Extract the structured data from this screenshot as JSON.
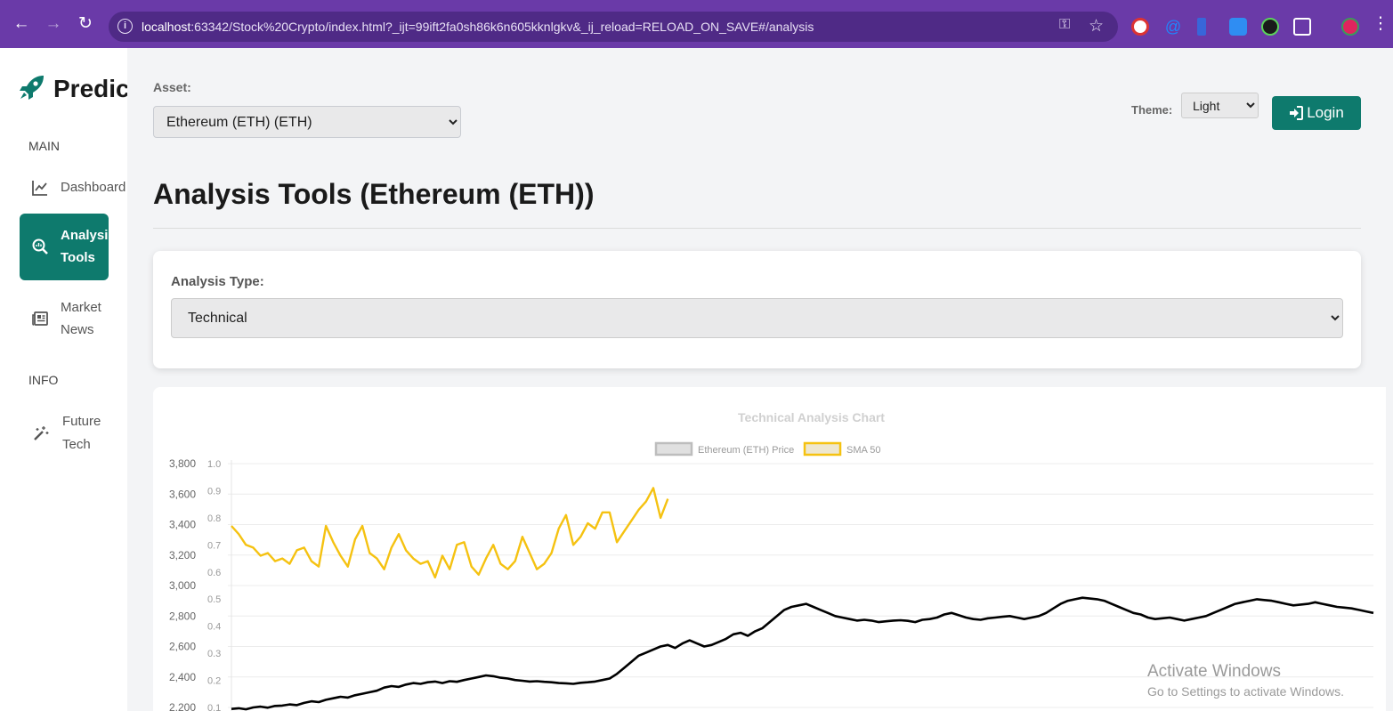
{
  "browser": {
    "url_host": "localhost",
    "url_path": ":63342/Stock%20Crypto/index.html?_ijt=99ift2fa0sh86k6n605kknlgkv&_ij_reload=RELOAD_ON_SAVE#/analysis",
    "icons": [
      "back-icon",
      "forward-icon",
      "reload-icon",
      "site-info-icon",
      "key-icon",
      "star-icon",
      "extensions-icon",
      "menu-icon"
    ]
  },
  "sidebar": {
    "logo_text": "Predic",
    "main_header": "MAIN",
    "info_header": "INFO",
    "items": [
      {
        "label_lines": [
          "Dashboard"
        ],
        "icon": "line-chart-icon",
        "active": false
      },
      {
        "label_lines": [
          "Analysis",
          "Tools"
        ],
        "icon": "search-chart-icon",
        "active": true
      },
      {
        "label_lines": [
          "Market",
          "News"
        ],
        "icon": "newspaper-icon",
        "active": false
      },
      {
        "label_lines": [
          "Future",
          "Tech"
        ],
        "icon": "magic-wand-icon",
        "active": false
      }
    ]
  },
  "header": {
    "asset_label": "Asset:",
    "asset_selected": "Ethereum (ETH) (ETH)",
    "theme_label": "Theme:",
    "theme_selected": "Light",
    "login_label": "Login",
    "page_title": "Analysis Tools (Ethereum (ETH))"
  },
  "analysis": {
    "type_label": "Analysis Type:",
    "type_selected": "Technical"
  },
  "chart_data": {
    "type": "line",
    "title": "Technical Analysis Chart",
    "legend_position": "top-center",
    "grid": true,
    "y_left": {
      "ticks": [
        "3,800",
        "3,600",
        "3,400",
        "3,200",
        "3,000",
        "2,800",
        "2,600",
        "2,400",
        "2,200"
      ],
      "range": [
        2200,
        3800
      ]
    },
    "y_right": {
      "ticks": [
        "1.0",
        "0.9",
        "0.8",
        "0.7",
        "0.6",
        "0.5",
        "0.4",
        "0.3",
        "0.2",
        "0.1"
      ],
      "range": [
        0.1,
        1.0
      ]
    },
    "series": [
      {
        "name": "Ethereum (ETH) Price",
        "color": "#000000",
        "axis": "left",
        "values": [
          2190,
          2195,
          2188,
          2200,
          2205,
          2198,
          2210,
          2212,
          2220,
          2215,
          2230,
          2240,
          2235,
          2250,
          2260,
          2270,
          2265,
          2280,
          2290,
          2300,
          2310,
          2330,
          2340,
          2335,
          2350,
          2360,
          2355,
          2365,
          2370,
          2360,
          2372,
          2368,
          2380,
          2390,
          2400,
          2410,
          2405,
          2395,
          2390,
          2380,
          2375,
          2370,
          2372,
          2368,
          2365,
          2360,
          2358,
          2355,
          2362,
          2365,
          2370,
          2380,
          2390,
          2420,
          2460,
          2500,
          2540,
          2560,
          2580,
          2600,
          2610,
          2590,
          2620,
          2640,
          2620,
          2600,
          2610,
          2630,
          2650,
          2680,
          2690,
          2670,
          2700,
          2720,
          2760,
          2800,
          2840,
          2860,
          2870,
          2880,
          2860,
          2840,
          2820,
          2800,
          2790,
          2780,
          2770,
          2775,
          2770,
          2760,
          2765,
          2770,
          2772,
          2768,
          2760,
          2775,
          2780,
          2790,
          2810,
          2820,
          2805,
          2790,
          2780,
          2775,
          2785,
          2790,
          2795,
          2800,
          2790,
          2780,
          2790,
          2800,
          2820,
          2850,
          2880,
          2900,
          2910,
          2920,
          2915,
          2910,
          2900,
          2880,
          2860,
          2840,
          2820,
          2810,
          2790,
          2780,
          2785,
          2790,
          2780,
          2770,
          2780,
          2790,
          2800,
          2820,
          2840,
          2860,
          2880,
          2890,
          2900,
          2910,
          2905,
          2900,
          2890,
          2880,
          2870,
          2875,
          2880,
          2890,
          2880,
          2870,
          2860,
          2855,
          2850,
          2840,
          2830,
          2820
        ]
      },
      {
        "name": "SMA 50",
        "color": "#f5c211",
        "axis": "right",
        "values": [
          0.77,
          0.74,
          0.7,
          0.69,
          0.66,
          0.67,
          0.64,
          0.65,
          0.63,
          0.68,
          0.69,
          0.64,
          0.62,
          0.77,
          0.71,
          0.66,
          0.62,
          0.72,
          0.77,
          0.67,
          0.65,
          0.61,
          0.69,
          0.74,
          0.68,
          0.65,
          0.63,
          0.64,
          0.58,
          0.66,
          0.61,
          0.7,
          0.71,
          0.62,
          0.59,
          0.65,
          0.7,
          0.63,
          0.61,
          0.64,
          0.73,
          0.67,
          0.61,
          0.63,
          0.67,
          0.76,
          0.81,
          0.7,
          0.73,
          0.78,
          0.76,
          0.82,
          0.82,
          0.71,
          0.75,
          0.79,
          0.83,
          0.86,
          0.91,
          0.8,
          0.87
        ]
      }
    ]
  },
  "windows_watermark": {
    "line1": "Activate Windows",
    "line2": "Go to Settings to activate Windows."
  }
}
